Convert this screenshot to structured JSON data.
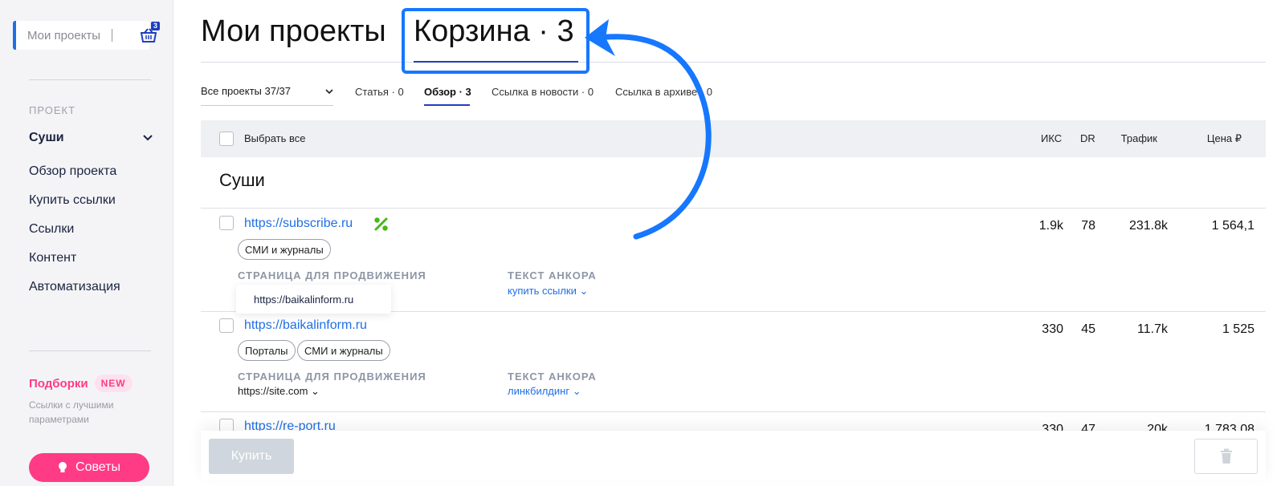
{
  "sidebar": {
    "projects_label": "Мои проекты",
    "cart_count": "3",
    "section_label": "ПРОЕКТ",
    "project_name": "Суши",
    "nav": [
      "Обзор проекта",
      "Купить ссылки",
      "Ссылки",
      "Контент",
      "Автоматизация"
    ],
    "podborki_label": "Подборки",
    "podborki_badge": "NEW",
    "podborki_sub": "Ссылки с лучшими параметрами",
    "tips_label": "Советы"
  },
  "header": {
    "title": "Мои проекты",
    "cart_tab": "Корзина · 3"
  },
  "filter": {
    "all_projects": "Все проекты 37/37",
    "tabs": [
      "Статья · 0",
      "Обзор · 3",
      "Ссылка в новости · 0",
      "Ссылка в архиве · 0"
    ],
    "active_tab_index": 1
  },
  "table": {
    "select_all": "Выбрать все",
    "columns": [
      "ИКС",
      "DR",
      "Трафик",
      "Цена ₽"
    ],
    "group_title": "Суши",
    "promo_label": "СТРАНИЦА ДЛЯ ПРОДВИЖЕНИЯ",
    "anchor_label": "ТЕКСТ АНКОРА",
    "rows": [
      {
        "url": "https://subscribe.ru",
        "tags": [
          "СМИ и журналы"
        ],
        "promo_page": "https://baikalinform.ru",
        "anchor": "купить ссылки",
        "iks": "1.9k",
        "dr": "78",
        "traffic": "231.8k",
        "price": "1 564,1"
      },
      {
        "url": "https://baikalinform.ru",
        "tags": [
          "Порталы",
          "СМИ и журналы"
        ],
        "promo_page": "https://site.com",
        "anchor": "линкбилдинг",
        "iks": "330",
        "dr": "45",
        "traffic": "11.7k",
        "price": "1 525"
      },
      {
        "url": "https://re-port.ru",
        "tags": [],
        "promo_page": "",
        "anchor": "",
        "iks": "330",
        "dr": "47",
        "traffic": "20k",
        "price": "1 783,08"
      }
    ],
    "tooltip": "https://baikalinform.ru"
  },
  "bottom": {
    "buy_label": "Купить"
  },
  "colors": {
    "accent_blue": "#1f6fe5",
    "pink": "#ff3b86",
    "highlight": "#1677ff",
    "discount_green": "#47b81b"
  }
}
